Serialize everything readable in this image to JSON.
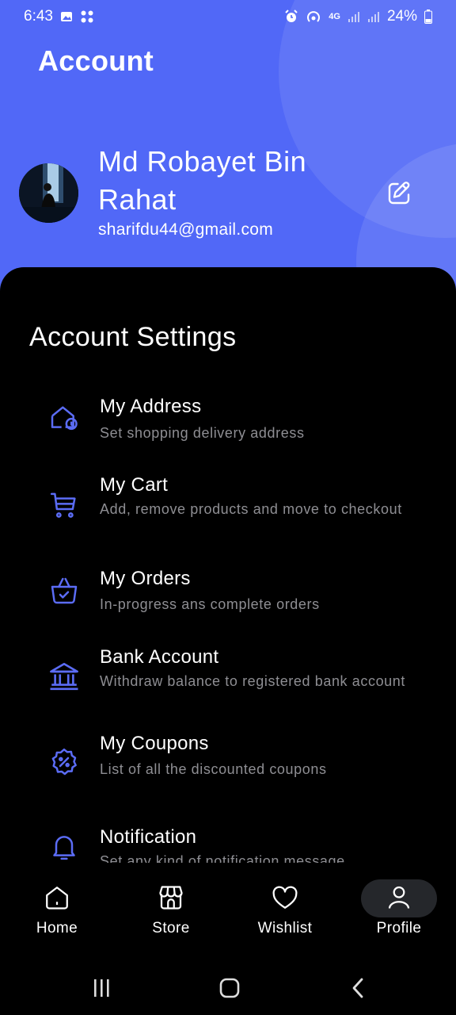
{
  "status_bar": {
    "time": "6:43",
    "network": "4G",
    "battery": "24%",
    "left_icons": [
      "image-icon",
      "dots-icon"
    ],
    "right_icons": [
      "alarm-icon",
      "hotspot-icon",
      "signal-icon",
      "signal-icon",
      "battery-icon"
    ]
  },
  "header": {
    "title": "Account",
    "background_color": "#5168f7"
  },
  "profile": {
    "name": "Md Robayet Bin Rahat",
    "email": "sharifdu44@gmail.com",
    "edit_icon": "edit-icon"
  },
  "settings": {
    "title": "Account Settings",
    "accent_color": "#5b6cf5",
    "items": [
      {
        "title": "My Address",
        "subtitle": "Set shopping delivery address",
        "icon": "home-location-icon"
      },
      {
        "title": "My Cart",
        "subtitle": "Add, remove products and move to checkout",
        "icon": "cart-icon"
      },
      {
        "title": "My Orders",
        "subtitle": "In-progress ans complete orders",
        "icon": "basket-icon"
      },
      {
        "title": "Bank Account",
        "subtitle": "Withdraw balance to registered bank account",
        "icon": "bank-icon"
      },
      {
        "title": "My Coupons",
        "subtitle": "List of all the discounted coupons",
        "icon": "coupon-icon"
      },
      {
        "title": "Notification",
        "subtitle": "Set any kind of notification message",
        "icon": "bell-icon"
      }
    ]
  },
  "bottom_nav": {
    "items": [
      {
        "label": "Home",
        "icon": "home-icon"
      },
      {
        "label": "Store",
        "icon": "store-icon"
      },
      {
        "label": "Wishlist",
        "icon": "heart-icon"
      },
      {
        "label": "Profile",
        "icon": "user-icon",
        "selected": true
      }
    ]
  },
  "system_nav": [
    "recents-icon",
    "home-circle-icon",
    "back-icon"
  ]
}
